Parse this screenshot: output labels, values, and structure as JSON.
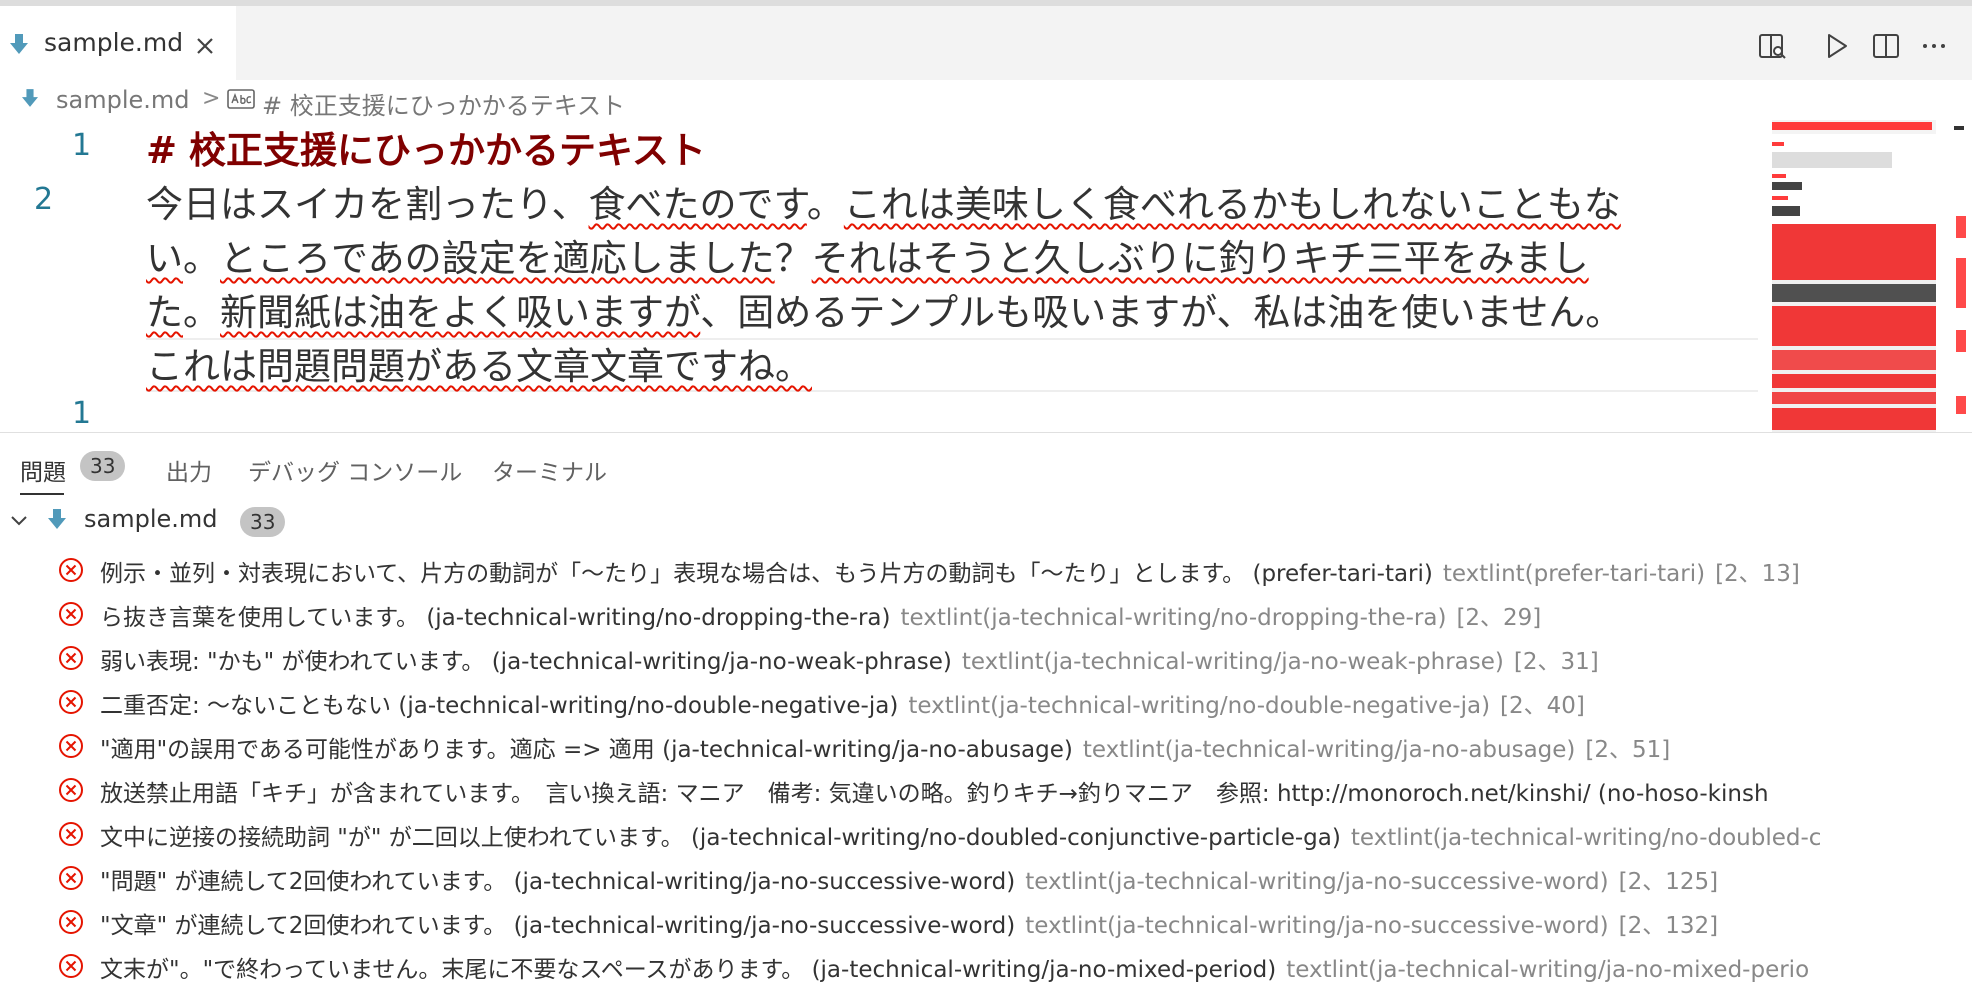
{
  "tab": {
    "label": "sample.md"
  },
  "breadcrumb": {
    "file": "sample.md",
    "separator": ">",
    "heading": "# 校正支援にひっかかるテキスト"
  },
  "editor": {
    "line_numbers": [
      "1",
      "2",
      "1"
    ],
    "heading_marker": "#",
    "heading_text": "校正支援にひっかかるテキスト",
    "paragraph": {
      "l1_a": "今日はスイカを割ったり、",
      "l1_b": "食べたのです",
      "l1_c": "。",
      "l1_d": "これは美味しく食べれるかもしれないこともな",
      "l2_a": "い",
      "l2_b": "。",
      "l2_c": "ところであの設定を適応しました",
      "l2_d": "？",
      "l2_e": "それはそうと久しぶりに釣りキチ三平をみまし",
      "l3_a": "た",
      "l3_b": "。",
      "l3_c": "新聞紙は油をよく吸いますが",
      "l3_d": "、固めるテンプルも吸いますが、私は油を使いません。",
      "l4_a": "これは問題問題がある文章文章ですね。"
    }
  },
  "panel": {
    "tabs": [
      {
        "label": "問題",
        "count": "33"
      },
      {
        "label": "出力"
      },
      {
        "label": "デバッグ コンソール"
      },
      {
        "label": "ターミナル"
      }
    ],
    "tree_file": {
      "label": "sample.md",
      "count": "33"
    },
    "problems": [
      {
        "msg": "例示・並列・対表現において、片方の動詞が「〜たり」表現な場合は、もう片方の動詞も「〜たり」とします。 (prefer-tari-tari)",
        "src": "textlint(prefer-tari-tari)",
        "loc": "[2、13]"
      },
      {
        "msg": "ら抜き言葉を使用しています。 (ja-technical-writing/no-dropping-the-ra)",
        "src": "textlint(ja-technical-writing/no-dropping-the-ra)",
        "loc": "[2、29]"
      },
      {
        "msg": "弱い表現: \"かも\" が使われています。 (ja-technical-writing/ja-no-weak-phrase)",
        "src": "textlint(ja-technical-writing/ja-no-weak-phrase)",
        "loc": "[2、31]"
      },
      {
        "msg": "二重否定: 〜ないこともない (ja-technical-writing/no-double-negative-ja)",
        "src": "textlint(ja-technical-writing/no-double-negative-ja)",
        "loc": "[2、40]"
      },
      {
        "msg": "\"適用\"の誤用である可能性があります。適応 => 適用 (ja-technical-writing/ja-no-abusage)",
        "src": "textlint(ja-technical-writing/ja-no-abusage)",
        "loc": "[2、51]"
      },
      {
        "msg": "放送禁止用語「キチ」が含まれています。　言い換え語: マニア　備考: 気違いの略。釣りキチ→釣りマニア　参照: http://monoroch.net/kinshi/ (no-hoso-kinsh",
        "src": "",
        "loc": ""
      },
      {
        "msg": "文中に逆接の接続助詞 \"が\" が二回以上使われています。 (ja-technical-writing/no-doubled-conjunctive-particle-ga)",
        "src": "textlint(ja-technical-writing/no-doubled-c",
        "loc": ""
      },
      {
        "msg": "\"問題\" が連続して2回使われています。 (ja-technical-writing/ja-no-successive-word)",
        "src": "textlint(ja-technical-writing/ja-no-successive-word)",
        "loc": "[2、125]"
      },
      {
        "msg": "\"文章\" が連続して2回使われています。 (ja-technical-writing/ja-no-successive-word)",
        "src": "textlint(ja-technical-writing/ja-no-successive-word)",
        "loc": "[2、132]"
      },
      {
        "msg": "文末が\"。\"で終わっていません。末尾に不要なスペースがあります。 (ja-technical-writing/ja-no-mixed-period)",
        "src": "textlint(ja-technical-writing/ja-no-mixed-perio",
        "loc": ""
      }
    ]
  },
  "colors": {
    "error": "#e51400",
    "heading": "#800000",
    "line_number": "#237893",
    "markdown_icon": "#519aba"
  }
}
